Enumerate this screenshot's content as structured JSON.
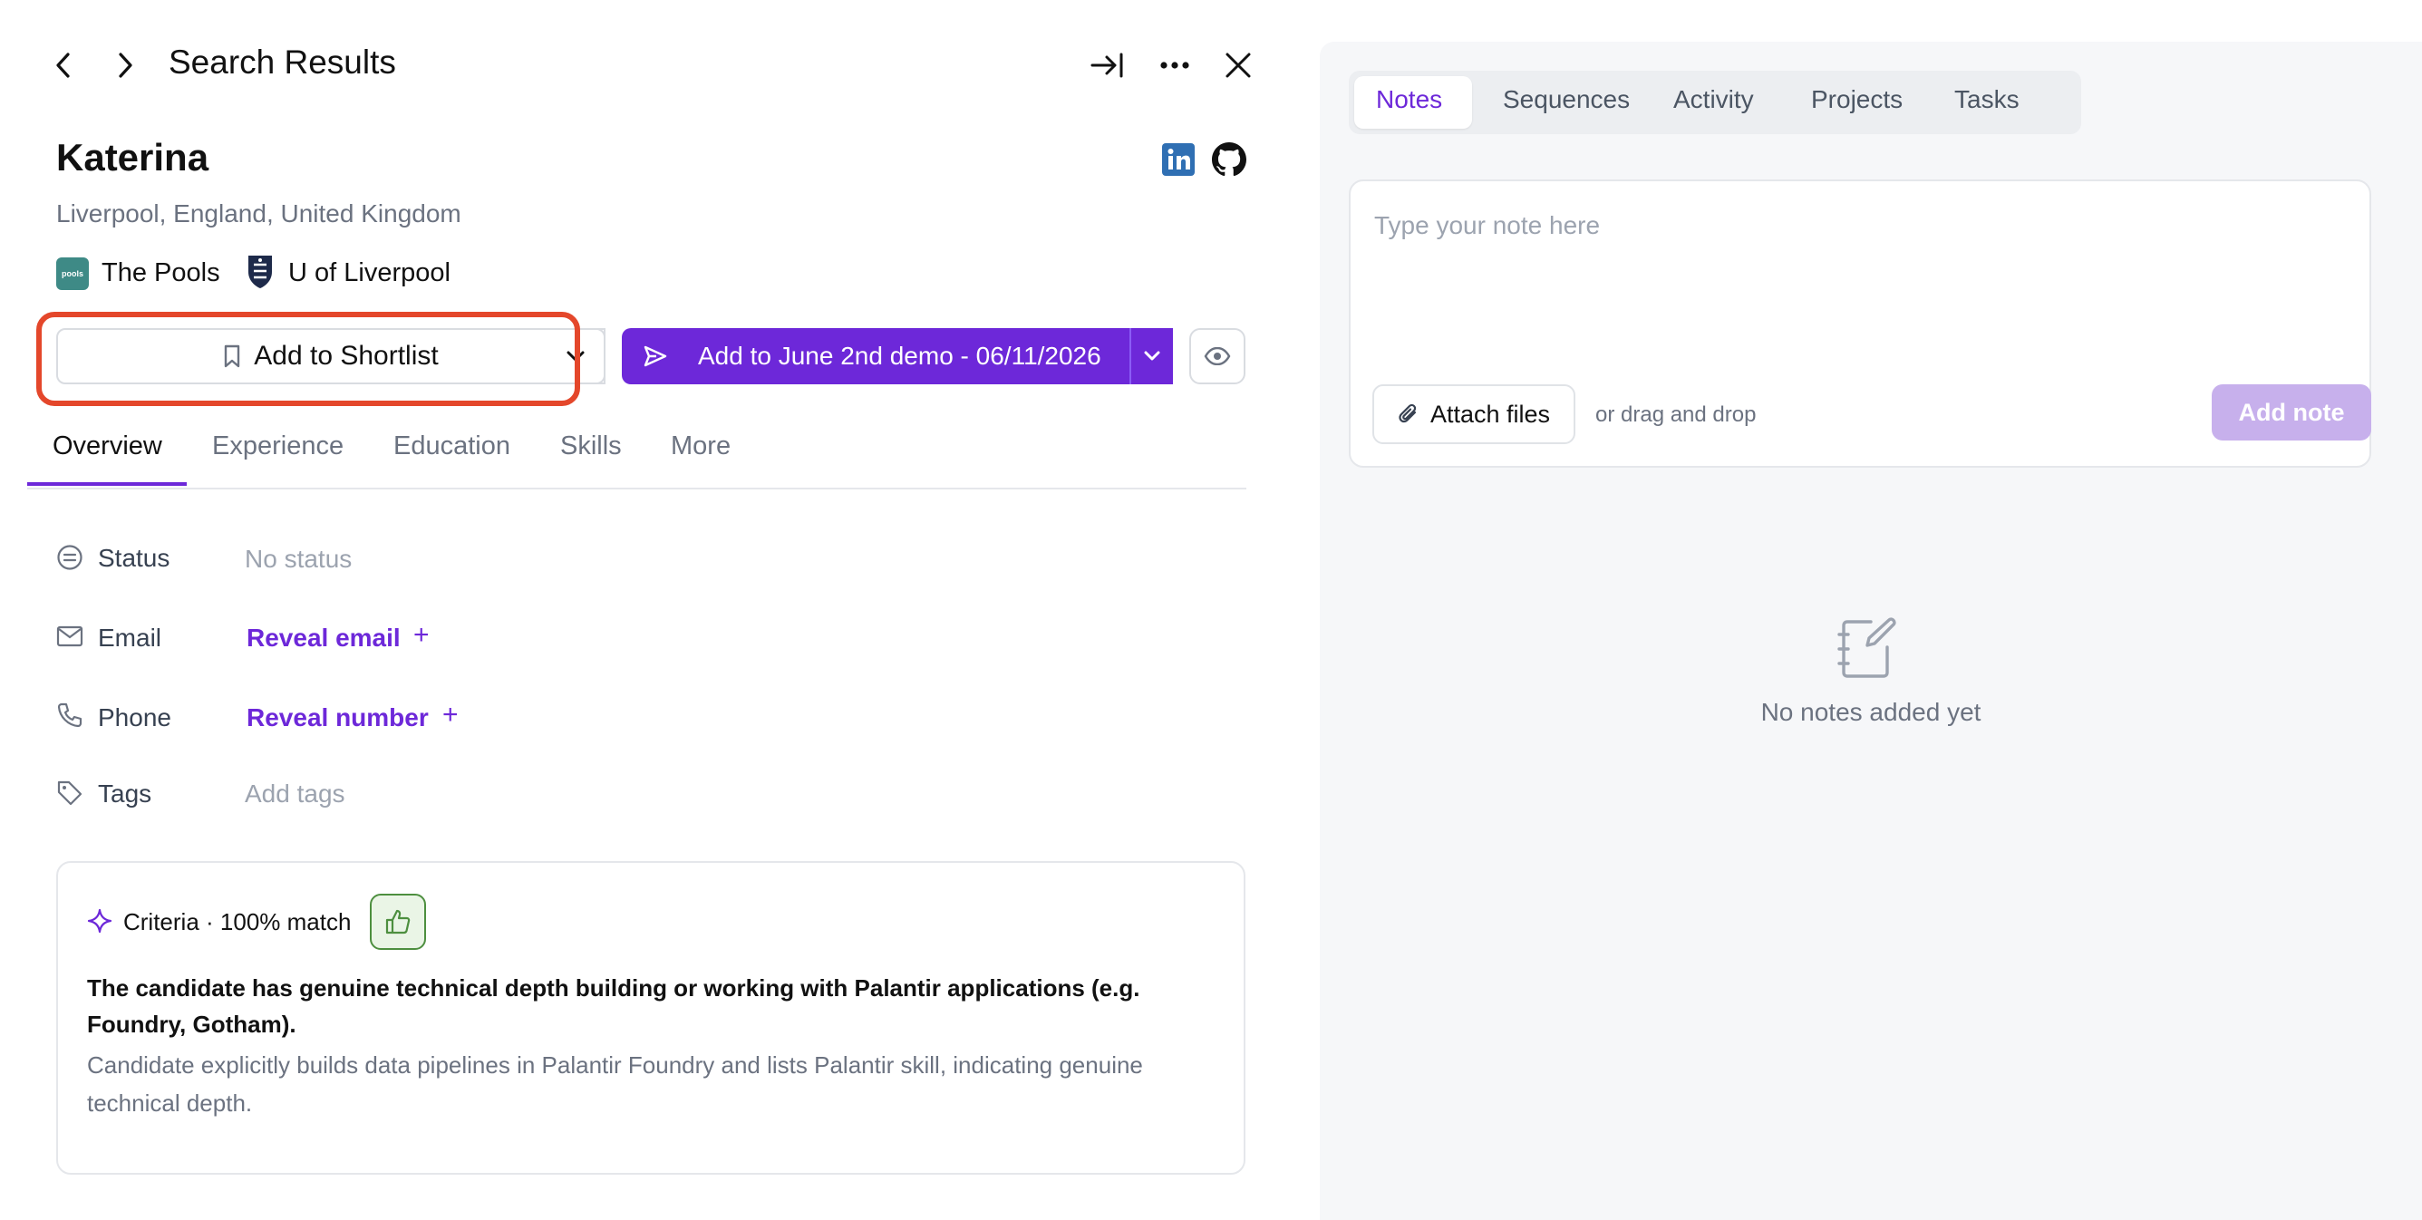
{
  "header": {
    "title": "Search Results"
  },
  "profile": {
    "name": "Katerina",
    "location": "Liverpool, England, United Kingdom",
    "company": "The Pools",
    "company_logo_text": "pools",
    "school": "U of Liverpool"
  },
  "actions": {
    "shortlist_label": "Add to Shortlist",
    "sequence_label": "Add to June 2nd demo - 06/11/2026"
  },
  "tabs": [
    "Overview",
    "Experience",
    "Education",
    "Skills",
    "More"
  ],
  "fields": {
    "status": {
      "label": "Status",
      "value": "No status"
    },
    "email": {
      "label": "Email",
      "value": "Reveal email"
    },
    "phone": {
      "label": "Phone",
      "value": "Reveal number"
    },
    "tags": {
      "label": "Tags",
      "value": "Add tags"
    }
  },
  "criteria": {
    "header": "Criteria · 100% match",
    "title": "The candidate has genuine technical depth building or working with Palantir applications (e.g. Foundry, Gotham).",
    "description": "Candidate explicitly builds data pipelines in Palantir Foundry and lists Palantir skill, indicating genuine technical depth."
  },
  "right_tabs": [
    "Notes",
    "Sequences",
    "Activity",
    "Projects",
    "Tasks"
  ],
  "notes": {
    "placeholder": "Type your note here",
    "attach_label": "Attach files",
    "drag_text": "or drag and drop",
    "add_label": "Add note",
    "empty_text": "No notes added yet"
  },
  "colors": {
    "accent": "#6d28d9",
    "highlight": "#e4472b",
    "success": "#4d8f3f"
  }
}
